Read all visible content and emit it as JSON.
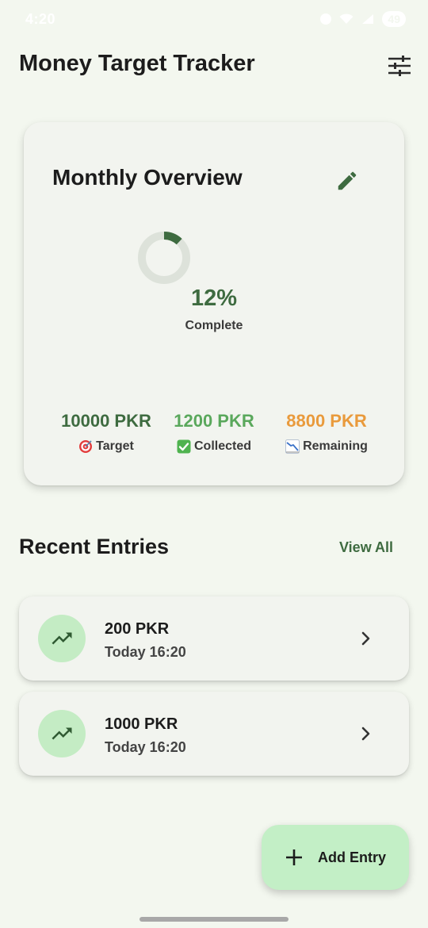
{
  "status_bar": {
    "time": "4:20",
    "battery": "49"
  },
  "header": {
    "title": "Money Target Tracker",
    "filter_icon": "tune-icon"
  },
  "overview": {
    "title": "Monthly Overview",
    "edit_icon": "pencil-icon",
    "progress_fraction": 0.12,
    "percent_text": "12%",
    "percent_label": "Complete",
    "stats": [
      {
        "value": "10000 PKR",
        "label": "Target",
        "icon": "target-icon",
        "color": "#3e6b40"
      },
      {
        "value": "1200 PKR",
        "label": "Collected",
        "icon": "check-mark-icon",
        "color": "#5aa85c"
      },
      {
        "value": "8800 PKR",
        "label": "Remaining",
        "icon": "chart-decreasing-icon",
        "color": "#e99a3c"
      }
    ]
  },
  "recent": {
    "title": "Recent Entries",
    "view_all": "View All",
    "entries": [
      {
        "amount": "200 PKR",
        "time": "Today 16:20",
        "icon": "trending-up-icon"
      },
      {
        "amount": "1000 PKR",
        "time": "Today 16:20",
        "icon": "trending-up-icon"
      }
    ]
  },
  "fab": {
    "label": "Add Entry",
    "icon": "plus-icon"
  },
  "colors": {
    "accent": "#3e6b40",
    "background": "#f3f7ef",
    "card": "#f2f4ef",
    "fab": "#c3efc6"
  }
}
